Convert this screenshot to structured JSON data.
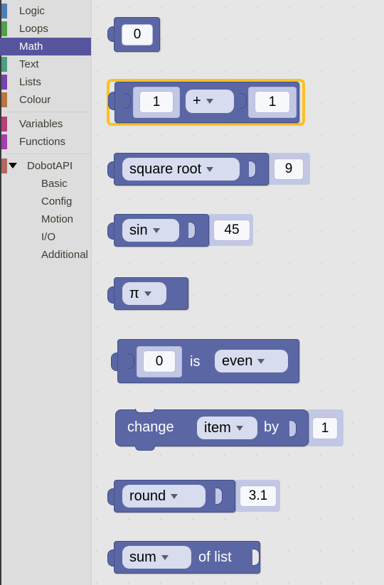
{
  "toolbox": {
    "categories": [
      {
        "label": "Logic",
        "color": "#4b7fb8",
        "selected": false,
        "sub": false
      },
      {
        "label": "Loops",
        "color": "#51a04b",
        "selected": false,
        "sub": false
      },
      {
        "label": "Math",
        "color": "#57549e",
        "selected": true,
        "sub": false
      },
      {
        "label": "Text",
        "color": "#4b9e83",
        "selected": false,
        "sub": false
      },
      {
        "label": "Lists",
        "color": "#7445ab",
        "selected": false,
        "sub": false
      },
      {
        "label": "Colour",
        "color": "#b9743f",
        "selected": false,
        "sub": false
      },
      {
        "label": "Variables",
        "color": "#b5407a",
        "selected": false,
        "sub": false
      },
      {
        "label": "Functions",
        "color": "#a53fb0",
        "selected": false,
        "sub": false
      },
      {
        "label": "DobotAPI",
        "color": "#b06a5e",
        "selected": false,
        "sub": false,
        "expander": true
      },
      {
        "label": "Basic",
        "color": "#b06a5e",
        "selected": false,
        "sub": true
      },
      {
        "label": "Config",
        "color": "#b06a5e",
        "selected": false,
        "sub": true
      },
      {
        "label": "Motion",
        "color": "#b06a5e",
        "selected": false,
        "sub": true
      },
      {
        "label": "I/O",
        "color": "#b06a5e",
        "selected": false,
        "sub": true
      },
      {
        "label": "Additional",
        "color": "#b06a5e",
        "selected": false,
        "sub": true
      }
    ]
  },
  "workspace": {
    "category_shown": "Math",
    "block_colour": "#5b67a5",
    "selection_colour": "#ffc020",
    "blocks": {
      "number_zero": {
        "value": "0"
      },
      "arithmetic": {
        "left": "1",
        "operator": "+",
        "right": "1",
        "selected": true
      },
      "single_op": {
        "operation": "square root",
        "value": "9"
      },
      "trig": {
        "operation": "sin",
        "value": "45"
      },
      "constant": {
        "value": "π"
      },
      "number_property": {
        "value": "0",
        "is_label": "is",
        "property": "even"
      },
      "change_variable": {
        "change_label": "change",
        "variable": "item",
        "by_label": "by",
        "delta": "1"
      },
      "round": {
        "operation": "round",
        "value": "3.1"
      },
      "list_op": {
        "operation": "sum",
        "of_list_label": "of list"
      }
    }
  }
}
